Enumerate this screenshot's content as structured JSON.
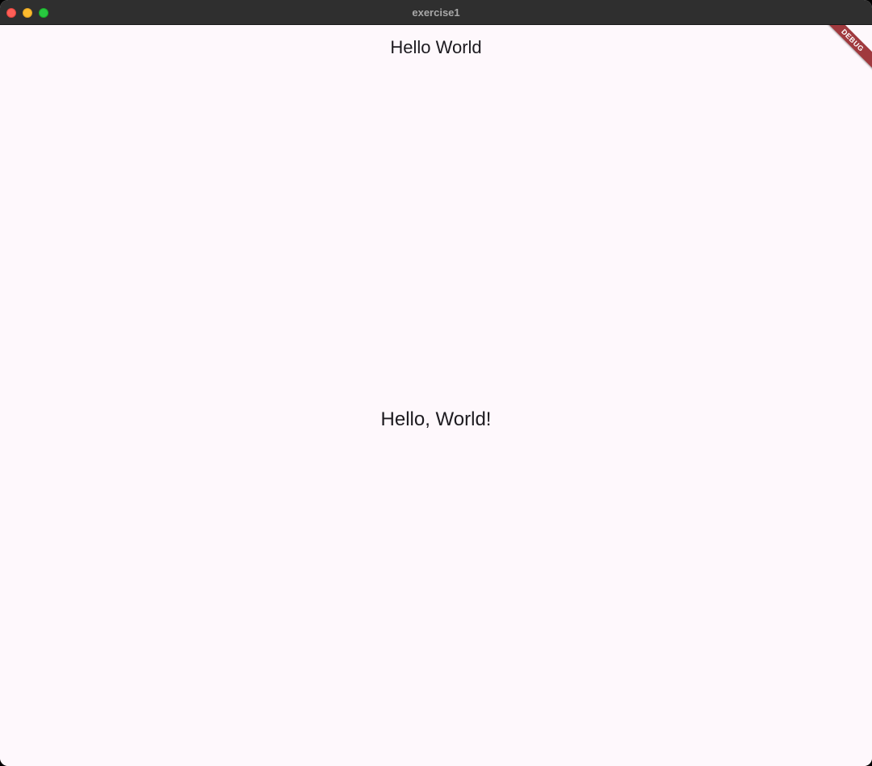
{
  "window": {
    "title": "exercise1",
    "controls": {
      "close_icon": "traffic-light-close",
      "minimize_icon": "traffic-light-minimize",
      "maximize_icon": "traffic-light-maximize"
    }
  },
  "appbar": {
    "title": "Hello World"
  },
  "body": {
    "text": "Hello, World!"
  },
  "debug_banner": {
    "label": "DEBUG"
  },
  "colors": {
    "titlebar": "#2f2f2f",
    "background": "#fef8fc",
    "text": "#1d1b20",
    "debug_banner": "#a0393e",
    "close": "#fe5f57",
    "minimize": "#febc2e",
    "maximize": "#28c840"
  }
}
